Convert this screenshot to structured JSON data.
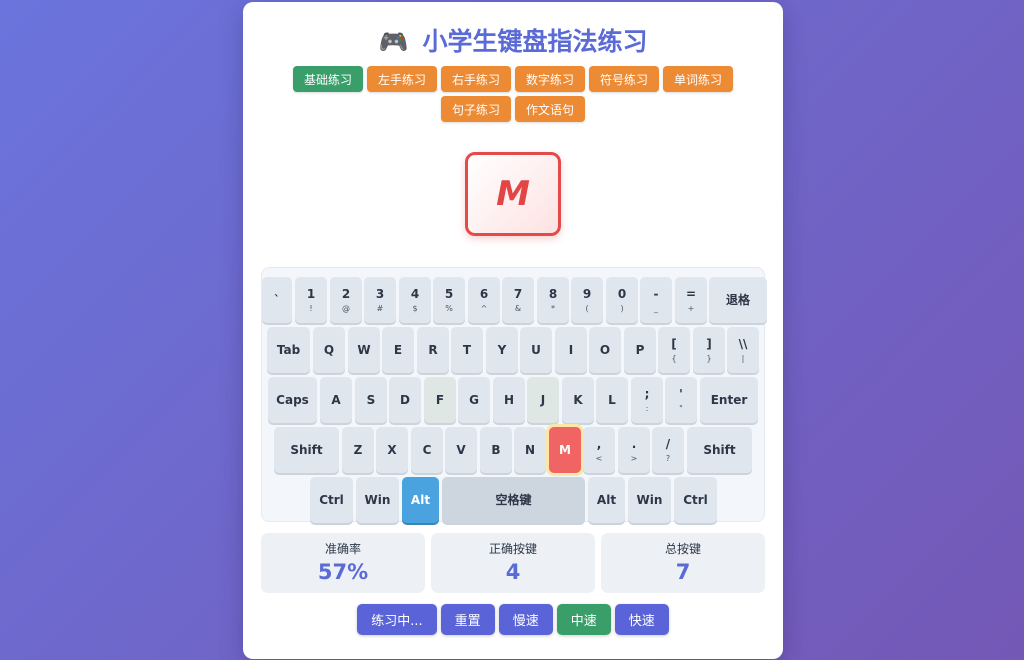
{
  "header": {
    "icon": "gamepad-icon",
    "icon_glyph": "🎮",
    "title": "小学生键盘指法练习"
  },
  "modes": [
    {
      "label": "基础练习",
      "active": true
    },
    {
      "label": "左手练习",
      "active": false
    },
    {
      "label": "右手练习",
      "active": false
    },
    {
      "label": "数字练习",
      "active": false
    },
    {
      "label": "符号练习",
      "active": false
    },
    {
      "label": "单词练习",
      "active": false
    },
    {
      "label": "句子练习",
      "active": false
    },
    {
      "label": "作文语句",
      "active": false
    }
  ],
  "target_key": "M",
  "keyboard": {
    "rows": [
      [
        {
          "main": "`",
          "sub": ""
        },
        {
          "main": "1",
          "sub": "!"
        },
        {
          "main": "2",
          "sub": "@"
        },
        {
          "main": "3",
          "sub": "#"
        },
        {
          "main": "4",
          "sub": "$"
        },
        {
          "main": "5",
          "sub": "%"
        },
        {
          "main": "6",
          "sub": "^"
        },
        {
          "main": "7",
          "sub": "&"
        },
        {
          "main": "8",
          "sub": "*"
        },
        {
          "main": "9",
          "sub": "("
        },
        {
          "main": "0",
          "sub": ")"
        },
        {
          "main": "-",
          "sub": "_"
        },
        {
          "main": "=",
          "sub": "+"
        },
        {
          "main": "退格",
          "sub": ""
        }
      ],
      [
        {
          "main": "Tab",
          "sub": ""
        },
        {
          "main": "Q",
          "sub": ""
        },
        {
          "main": "W",
          "sub": ""
        },
        {
          "main": "E",
          "sub": ""
        },
        {
          "main": "R",
          "sub": ""
        },
        {
          "main": "T",
          "sub": ""
        },
        {
          "main": "Y",
          "sub": ""
        },
        {
          "main": "U",
          "sub": ""
        },
        {
          "main": "I",
          "sub": ""
        },
        {
          "main": "O",
          "sub": ""
        },
        {
          "main": "P",
          "sub": ""
        },
        {
          "main": "[",
          "sub": "{"
        },
        {
          "main": "]",
          "sub": "}"
        },
        {
          "main": "\\\\",
          "sub": "|"
        }
      ],
      [
        {
          "main": "Caps",
          "sub": ""
        },
        {
          "main": "A",
          "sub": ""
        },
        {
          "main": "S",
          "sub": ""
        },
        {
          "main": "D",
          "sub": ""
        },
        {
          "main": "F",
          "sub": ""
        },
        {
          "main": "G",
          "sub": ""
        },
        {
          "main": "H",
          "sub": ""
        },
        {
          "main": "J",
          "sub": ""
        },
        {
          "main": "K",
          "sub": ""
        },
        {
          "main": "L",
          "sub": ""
        },
        {
          "main": ";",
          "sub": ":"
        },
        {
          "main": "'",
          "sub": "\""
        },
        {
          "main": "Enter",
          "sub": ""
        }
      ],
      [
        {
          "main": "Shift",
          "sub": ""
        },
        {
          "main": "Z",
          "sub": ""
        },
        {
          "main": "X",
          "sub": ""
        },
        {
          "main": "C",
          "sub": ""
        },
        {
          "main": "V",
          "sub": ""
        },
        {
          "main": "B",
          "sub": ""
        },
        {
          "main": "N",
          "sub": ""
        },
        {
          "main": "M",
          "sub": ""
        },
        {
          "main": ",",
          "sub": "<"
        },
        {
          "main": ".",
          "sub": ">"
        },
        {
          "main": "/",
          "sub": "?"
        },
        {
          "main": "Shift",
          "sub": ""
        }
      ],
      [
        {
          "main": "Ctrl",
          "sub": ""
        },
        {
          "main": "Win",
          "sub": ""
        },
        {
          "main": "Alt",
          "sub": ""
        },
        {
          "main": "空格键",
          "sub": ""
        },
        {
          "main": "Alt",
          "sub": ""
        },
        {
          "main": "Win",
          "sub": ""
        },
        {
          "main": "Ctrl",
          "sub": ""
        }
      ]
    ],
    "highlighted_key": "M",
    "finger_hint_key": "Alt"
  },
  "stats": [
    {
      "label": "准确率",
      "value": "57%"
    },
    {
      "label": "正确按键",
      "value": "4"
    },
    {
      "label": "总按键",
      "value": "7"
    }
  ],
  "controls": [
    {
      "label": "练习中...",
      "active": false
    },
    {
      "label": "重置",
      "active": false
    },
    {
      "label": "慢速",
      "active": false
    },
    {
      "label": "中速",
      "active": true
    },
    {
      "label": "快速",
      "active": false
    }
  ],
  "colors": {
    "accent": "#5a6ad6",
    "mode_active": "#3a9e6a",
    "mode_default": "#ed8a34",
    "target_border": "#e34b4b",
    "key_highlight": "#f06464",
    "key_hint": "#4aa3df"
  }
}
